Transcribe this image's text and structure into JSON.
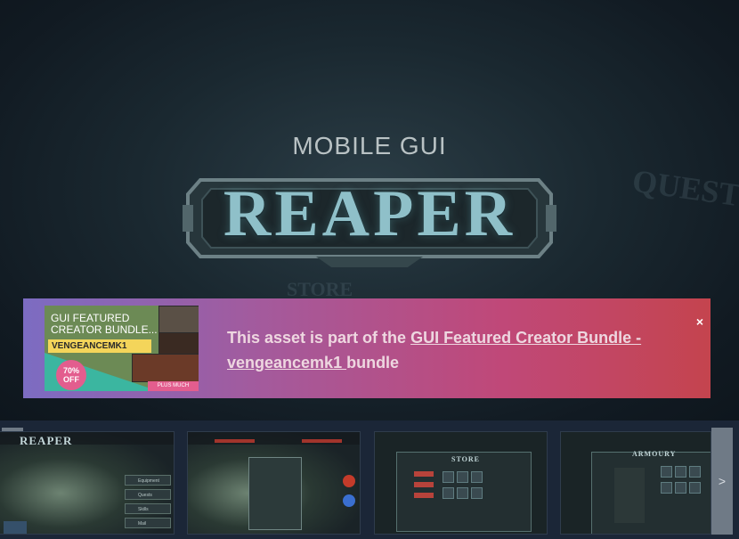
{
  "hero": {
    "subtitle": "MOBILE GUI",
    "title": "REAPER",
    "background_words": [
      "QUEST",
      "STORE"
    ]
  },
  "banner": {
    "bundle_image": {
      "title": "GUI FEATURED CREATOR BUNDLE...",
      "creator": "VENGEANCEMK1",
      "discount": "70% OFF",
      "more_label": "PLUS MUCH MORE..."
    },
    "text_prefix": "This asset is part of the ",
    "link_text": "GUI Featured Creator Bundle - vengeancemk1 ",
    "text_suffix": " bundle",
    "close_label": "×",
    "colors": {
      "start": "#7c6cc2",
      "end": "#c4444e"
    }
  },
  "gallery": {
    "prev_label": "<",
    "next_label": ">",
    "thumbs": [
      {
        "title": "REAPER",
        "menu": [
          "Equipment",
          "Quests",
          "Skills",
          "Mail"
        ]
      },
      {
        "title": ""
      },
      {
        "title": "STORE"
      },
      {
        "title": "ARMOURY"
      }
    ]
  }
}
